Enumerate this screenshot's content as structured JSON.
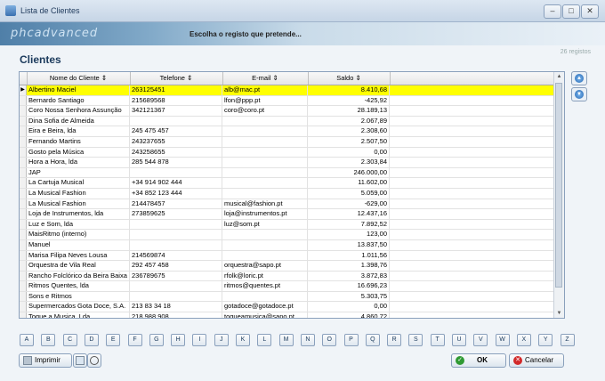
{
  "window": {
    "title": "Lista de Clientes"
  },
  "banner": {
    "logo": "phcadvanced",
    "message": "Escolha o registo que pretende..."
  },
  "record_count": "26 registos",
  "heading": "Clientes",
  "columns": [
    "Nome do Cliente",
    "Telefone",
    "E-mail",
    "Saldo"
  ],
  "rows": [
    [
      "Albertino Maciel",
      "263125451",
      "alb@mac.pt",
      "8.410,68"
    ],
    [
      "Bernardo Santiago",
      "215689568",
      "lfon@ppp.pt",
      "-425,92"
    ],
    [
      "Coro Nossa Senhora Assunção",
      "342121367",
      "coro@coro.pt",
      "28.189,13"
    ],
    [
      "Dina Sofia de Almeida",
      "",
      "",
      "2.067,89"
    ],
    [
      "Eira e Beira, lda",
      "245 475 457",
      "",
      "2.308,60"
    ],
    [
      "Fernando Martins",
      "243237655",
      "",
      "2.507,50"
    ],
    [
      "Gosto pela Música",
      "243258655",
      "",
      "0,00"
    ],
    [
      "Hora a Hora, lda",
      "285 544 878",
      "",
      "2.303,84"
    ],
    [
      "JAP",
      "",
      "",
      "246.000,00"
    ],
    [
      "La Cartuja Musical",
      "+34 914 902 444",
      "",
      "11.602,00"
    ],
    [
      "La Musical Fashion",
      "+34 852 123 444",
      "",
      "5.059,00"
    ],
    [
      "La Musical Fashion",
      "214478457",
      "musical@fashion.pt",
      "-629,00"
    ],
    [
      "Loja de Instrumentos, lda",
      "273859625",
      "loja@instrumentos.pt",
      "12.437,16"
    ],
    [
      "Luz e Som, lda",
      "",
      "luz@som.pt",
      "7.892,52"
    ],
    [
      "MaisRitmo (interno)",
      "",
      "",
      "123,00"
    ],
    [
      "Manuel",
      "",
      "",
      "13.837,50"
    ],
    [
      "Marisa Filipa Neves Lousa",
      "214569874",
      "",
      "1.011,56"
    ],
    [
      "Orquestra de Vila Real",
      "292 457 458",
      "orquestra@sapo.pt",
      "1.398,76"
    ],
    [
      "Rancho Folclórico da Beira Baixa",
      "236789675",
      "rfolk@loric.pt",
      "3.872,83"
    ],
    [
      "Ritmos Quentes, lda",
      "",
      "ritmos@quentes.pt",
      "16.696,23"
    ],
    [
      "Sons e Ritmos",
      "",
      "",
      "5.303,75"
    ],
    [
      "Supermercados Gota Doce, S.A.",
      "213 83 34 18",
      "gotadoce@gotadoce.pt",
      "0,00"
    ],
    [
      "Toque a Musica, Lda.",
      "218 988 908",
      "toqueamusica@sapo.pt",
      "4.860,72"
    ],
    [
      "",
      "",
      "",
      ""
    ]
  ],
  "selected_row": 0,
  "letters": [
    "A",
    "B",
    "C",
    "D",
    "E",
    "F",
    "G",
    "H",
    "I",
    "J",
    "K",
    "L",
    "M",
    "N",
    "O",
    "P",
    "Q",
    "R",
    "S",
    "T",
    "U",
    "V",
    "W",
    "X",
    "Y",
    "Z"
  ],
  "buttons": {
    "print": "Imprimir",
    "ok": "OK",
    "cancel": "Cancelar"
  },
  "colors": {
    "selection": "#ffff00",
    "accent": "#1b3a5c"
  }
}
